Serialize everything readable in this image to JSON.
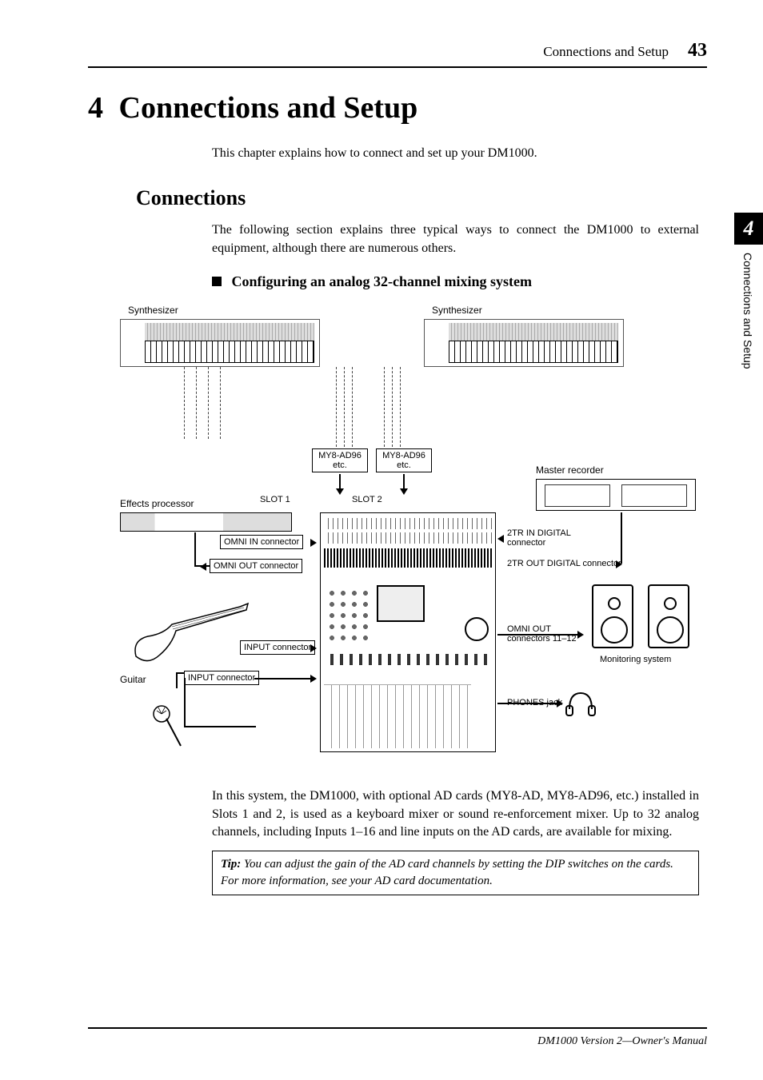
{
  "header": {
    "title": "Connections and Setup",
    "page": "43"
  },
  "chapter": {
    "number": "4",
    "title": "Connections and Setup"
  },
  "intro": "This chapter explains how to connect and set up your DM1000.",
  "section": {
    "heading": "Connections",
    "paragraph": "The following section explains three typical ways to connect the DM1000 to external equipment, although there are numerous others."
  },
  "subheading": "Configuring an analog 32-channel mixing system",
  "diagram": {
    "synthesizer_l": "Synthesizer",
    "synthesizer_r": "Synthesizer",
    "slot1_box": "MY8-AD96\netc.",
    "slot2_box": "MY8-AD96\netc.",
    "slot1_label": "SLOT 1",
    "slot2_label": "SLOT 2",
    "effects": "Effects processor",
    "omni_in": "OMNI IN connector",
    "omni_out": "OMNI OUT connector",
    "input_conn_1": "INPUT connector",
    "input_conn_2": "INPUT connector",
    "guitar": "Guitar",
    "master_rec": "Master recorder",
    "twotr_in": "2TR IN DIGITAL\nconnector",
    "twotr_out": "2TR OUT DIGITAL connector",
    "omni_out_1112": "OMNI OUT\nconnectors 11–12",
    "monitoring": "Monitoring system",
    "phones": "PHONES jack"
  },
  "body_p": "In this system, the DM1000, with optional AD cards (MY8-AD, MY8-AD96, etc.) installed in Slots 1 and 2, is used as a keyboard mixer or sound re-enforcement mixer. Up to 32 analog channels, including Inputs 1–16 and line inputs on the AD cards, are available for mixing.",
  "tip": {
    "label": "Tip:",
    "text": "You can adjust the gain of the AD card channels by setting the DIP switches on the cards. For more information, see your AD card documentation."
  },
  "sidetab": {
    "number": "4",
    "text": "Connections and Setup"
  },
  "footer": "DM1000 Version 2—Owner's Manual"
}
